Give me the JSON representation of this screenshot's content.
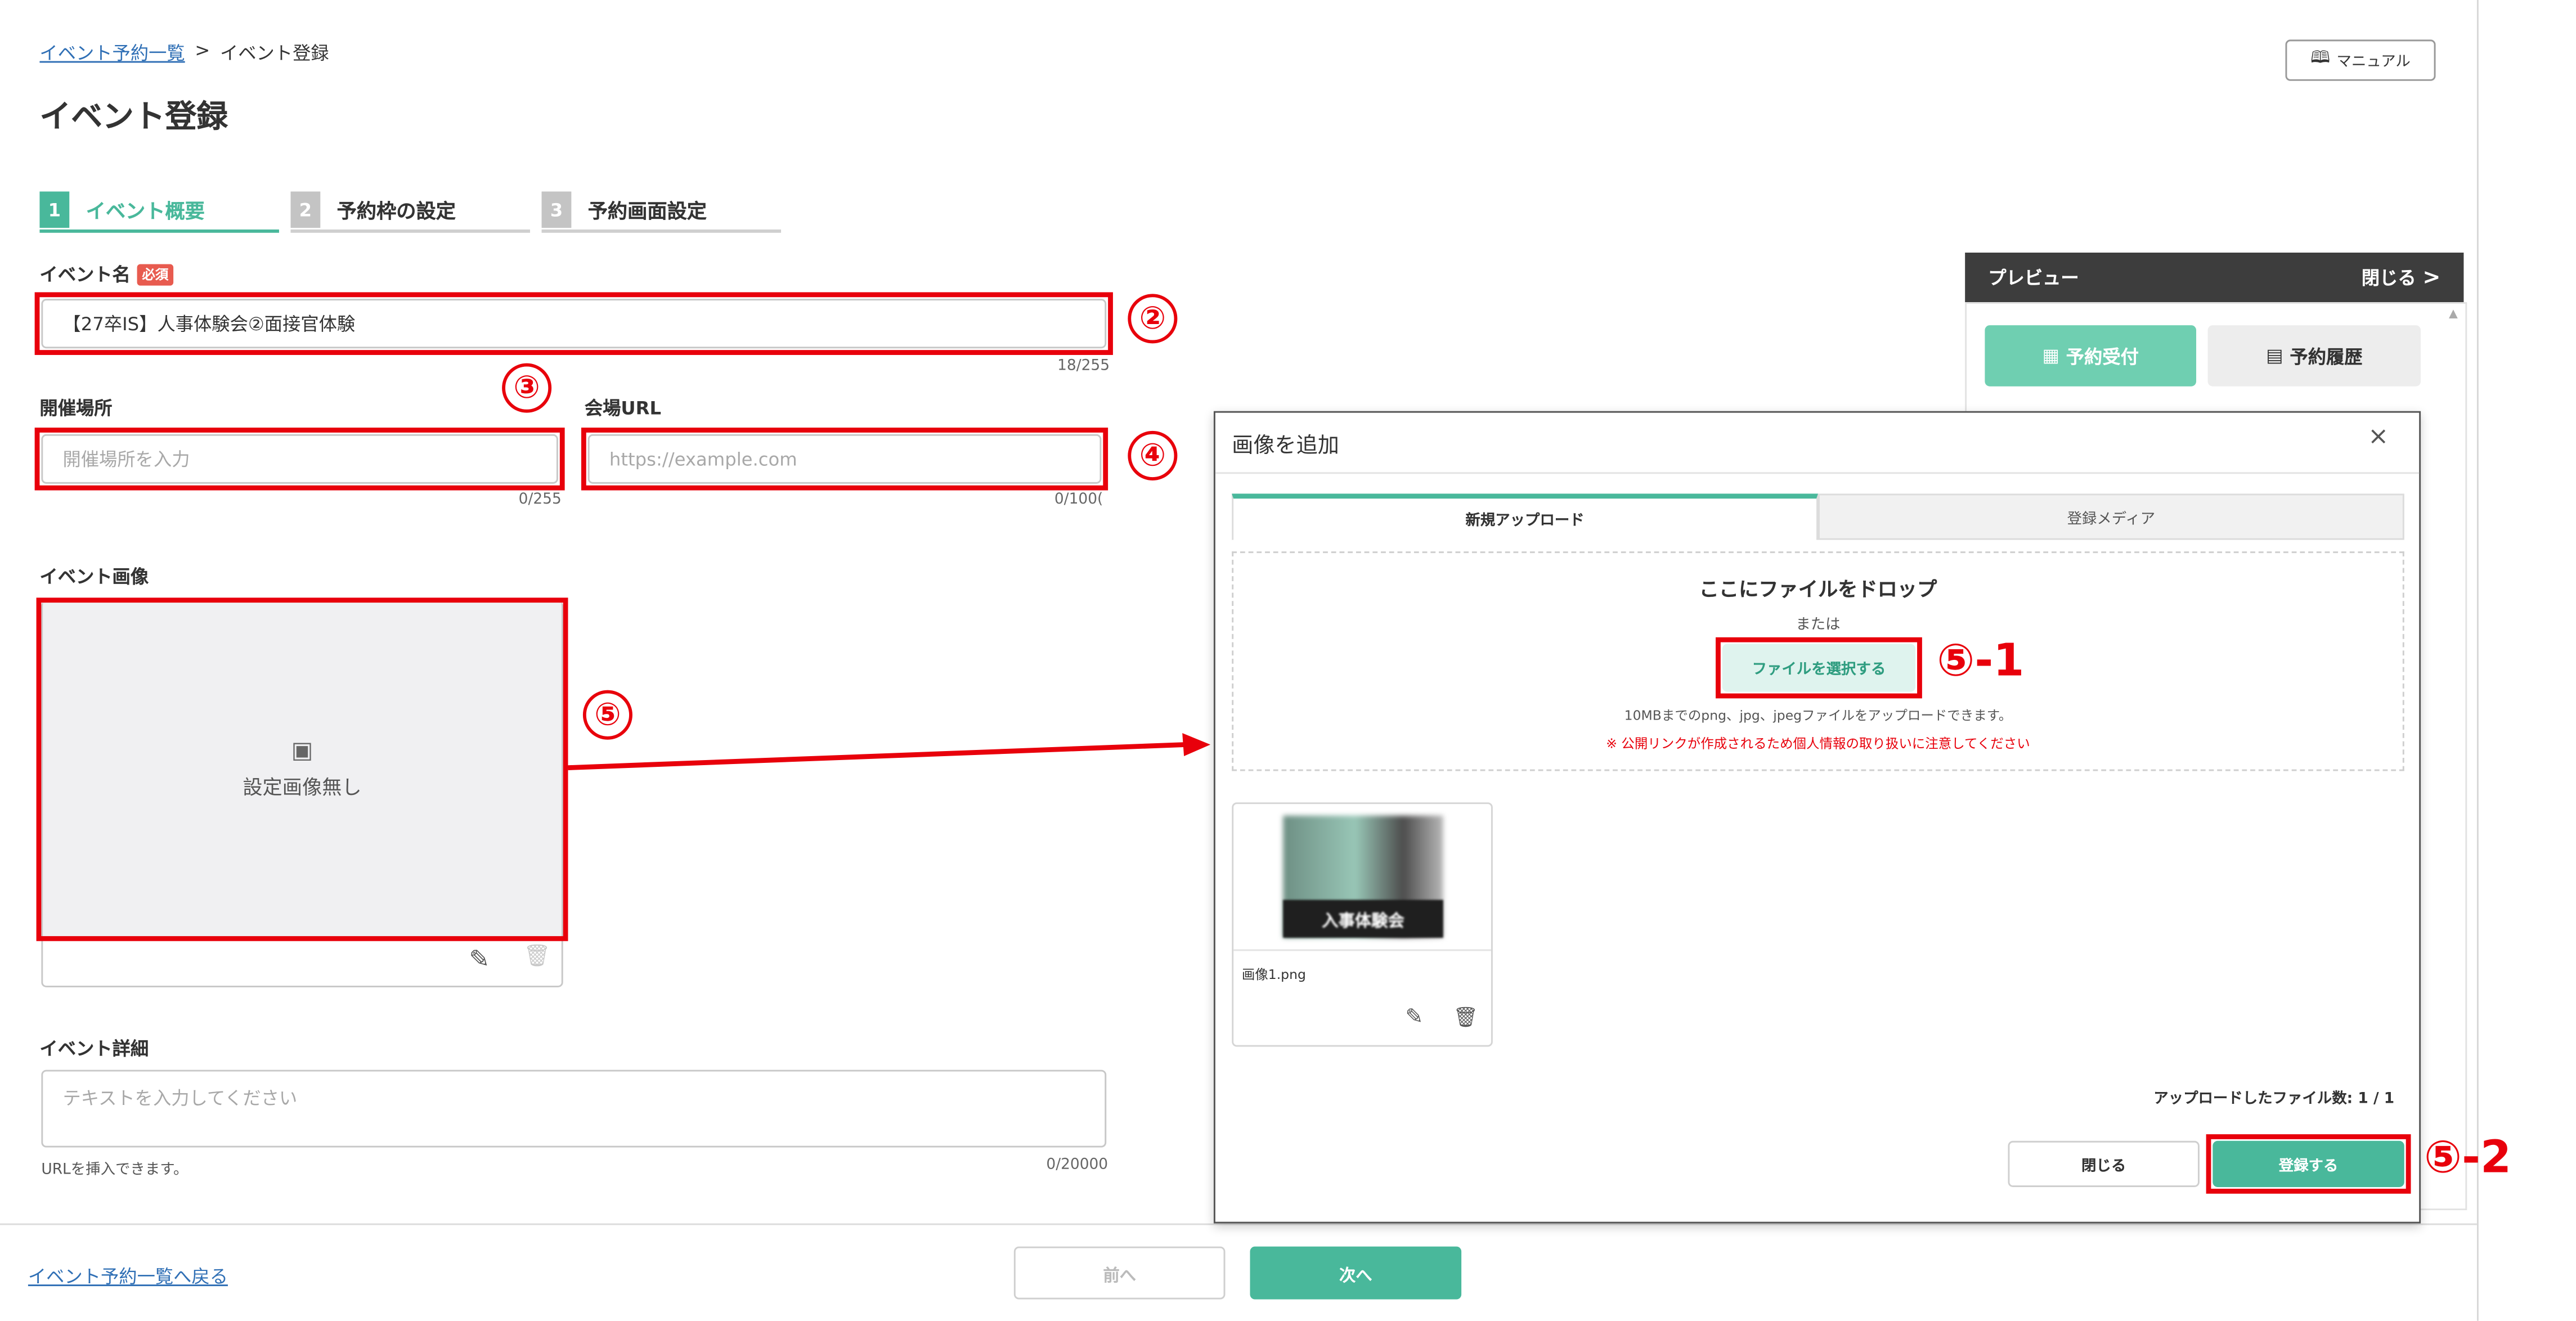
{
  "breadcrumb": {
    "parent": "イベント予約一覧",
    "separator": ">",
    "current": "イベント登録"
  },
  "page_title": "イベント登録",
  "manual_button": "マニュアル",
  "steps": [
    {
      "num": "1",
      "label": "イベント概要"
    },
    {
      "num": "2",
      "label": "予約枠の設定"
    },
    {
      "num": "3",
      "label": "予約画面設定"
    }
  ],
  "event_name": {
    "label": "イベント名",
    "required": "必須",
    "value": "【27卒IS】人事体験会②面接官体験",
    "counter": "18/255"
  },
  "venue": {
    "label": "開催場所",
    "placeholder": "開催場所を入力",
    "counter": "0/255"
  },
  "venue_url": {
    "label": "会場URL",
    "placeholder": "https://example.com",
    "counter": "0/100("
  },
  "event_image": {
    "label": "イベント画像",
    "empty_text": "設定画像無し"
  },
  "event_detail": {
    "label": "イベント詳細",
    "placeholder": "テキストを入力してください",
    "hint": "URLを挿入できます。",
    "counter": "0/20000"
  },
  "footer": {
    "back_link": "イベント予約一覧へ戻る",
    "prev": "前へ",
    "next": "次へ"
  },
  "preview": {
    "title": "プレビュー",
    "close": "閉じる",
    "tab_reserve": "予約受付",
    "tab_history": "予約履歴"
  },
  "modal": {
    "title": "画像を追加",
    "close_x": "×",
    "tab_new": "新規アップロード",
    "tab_media": "登録メディア",
    "drop_text": "ここにファイルをドロップ",
    "or": "または",
    "select_button": "ファイルを選択する",
    "limit_text": "10MBまでのpng、jpg、jpegファイルをアップロードできます。",
    "warning": "※ 公開リンクが作成されるため個人情報の取り扱いに注意してください",
    "thumb_text": "入事体験会",
    "file_name": "画像1.png",
    "upload_count": "アップロードしたファイル数: 1 / 1",
    "close_button": "閉じる",
    "register_button": "登録する"
  },
  "annotations": {
    "n2": "②",
    "n3": "③",
    "n4": "④",
    "n5": "⑤",
    "n5_1": "⑤-1",
    "n5_2": "⑤-2"
  },
  "colors": {
    "accent": "#49b89b",
    "annotation": "#e8000b",
    "link": "#2f6fb5"
  }
}
